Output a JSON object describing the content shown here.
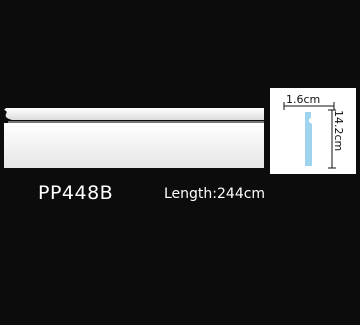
{
  "product": {
    "code": "PP448B",
    "length_text": "Length:244cm"
  },
  "profile": {
    "width_text": "1.6cm",
    "height_text": "14.2cm",
    "section_color": "#9fd4ef"
  },
  "colors": {
    "background": "#0c0c0c",
    "molding": "#f2f2f2",
    "text": "#ffffff"
  }
}
